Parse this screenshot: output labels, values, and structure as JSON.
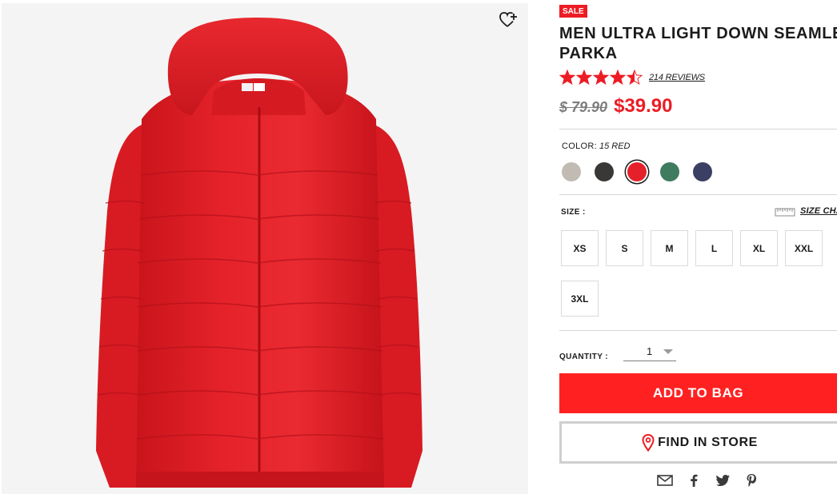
{
  "product": {
    "badge": "SALE",
    "title_line1": "MEN ULTRA LIGHT DOWN SEAMLESS",
    "title_line2": "PARKA",
    "rating": 4.5,
    "rating_max": 5,
    "reviews_label": "214 REVIEWS",
    "original_price": "$ 79.90",
    "sale_price": "$39.90"
  },
  "color": {
    "label": "COLOR:",
    "selected": "15 RED",
    "swatches": [
      {
        "name": "gray",
        "hex": "#c2bbb4"
      },
      {
        "name": "black",
        "hex": "#3a3836"
      },
      {
        "name": "red",
        "hex": "#e6202a",
        "selected": true
      },
      {
        "name": "green",
        "hex": "#3f7b5e"
      },
      {
        "name": "navy",
        "hex": "#3b3f63"
      }
    ]
  },
  "size": {
    "label": "SIZE :",
    "chart_label": "SIZE CHART",
    "options": [
      "XS",
      "S",
      "M",
      "L",
      "XL",
      "XXL",
      "3XL"
    ]
  },
  "quantity": {
    "label": "QUANTITY :",
    "value": "1"
  },
  "actions": {
    "add_to_bag": "ADD TO BAG",
    "find_in_store": "FIND IN STORE"
  },
  "share": {
    "icons": [
      "email-icon",
      "facebook-icon",
      "twitter-icon",
      "pinterest-icon"
    ]
  },
  "colors": {
    "accent": "#ff2121",
    "sale_badge": "#ed1c24",
    "price_red": "#ed1c24",
    "jacket": "#e11f1f"
  }
}
